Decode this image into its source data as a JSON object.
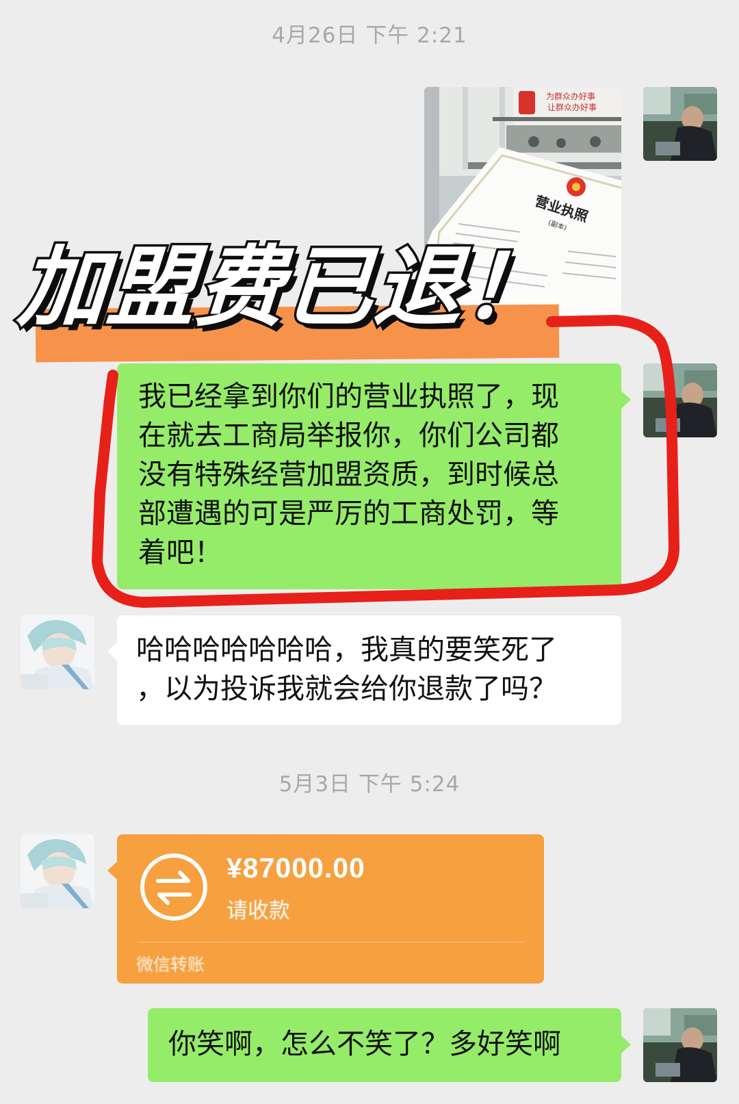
{
  "chat": {
    "timestamp_1": "4月26日 下午 2:21",
    "timestamp_2": "5月3日 下午 5:24",
    "messages": [
      {
        "sender": "me",
        "type": "image",
        "content": "营业执照"
      },
      {
        "sender": "me",
        "type": "text",
        "lines": [
          "我已经拿到你们的营业执照了，现",
          "在就去工商局举报你，你们公司都",
          "没有特殊经营加盟资质，到时候总",
          "部遭遇的可是严厉的工商处罚，等",
          "着吧！"
        ]
      },
      {
        "sender": "other",
        "type": "text",
        "lines": [
          "哈哈哈哈哈哈哈，我真的要笑死了",
          "，以为投诉我就会给你退款了吗？"
        ]
      },
      {
        "sender": "other",
        "type": "transfer",
        "amount": "¥87000.00",
        "status": "请收款",
        "footer": "微信转账"
      },
      {
        "sender": "me",
        "type": "text",
        "lines": [
          "你笑啊，怎么不笑了？多好笑啊"
        ]
      }
    ]
  },
  "overlay": {
    "title": "加盟费已退！"
  },
  "license_photo": {
    "title": "营业执照",
    "subtitle": "(副本)",
    "banner": "为群众办好事",
    "banner2": "让群众办好事"
  },
  "colors": {
    "background": "#ededed",
    "my_bubble": "#95ec69",
    "their_bubble": "#ffffff",
    "transfer": "#f6a040",
    "highlight": "#e8201a",
    "band": "#f7924b"
  },
  "icons": {
    "transfer": "transfer-arrows-icon"
  }
}
